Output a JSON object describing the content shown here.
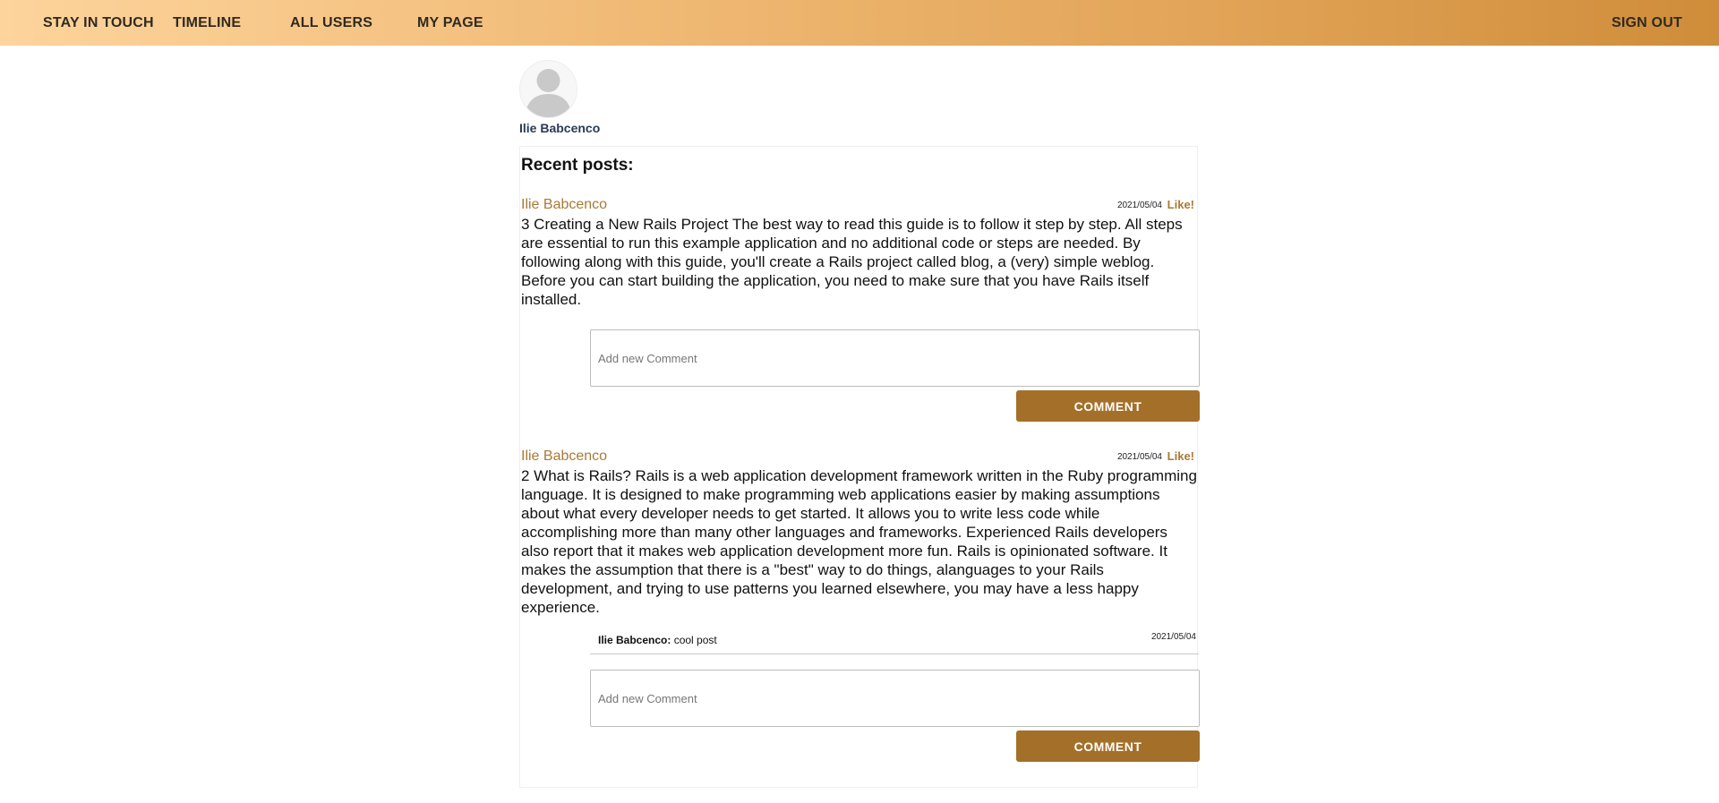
{
  "nav": {
    "stay_in_touch": "STAY IN TOUCH",
    "timeline": "TIMELINE",
    "all_users": "ALL USERS",
    "my_page": "MY PAGE",
    "sign_out": "SIGN OUT"
  },
  "profile": {
    "name": "Ilie Babcenco"
  },
  "recent_posts": {
    "heading": "Recent posts:",
    "like_label": "Like!",
    "comment_placeholder": "Add new Comment",
    "comment_button": "COMMENT",
    "posts": [
      {
        "author": "Ilie Babcenco",
        "date": "2021/05/04",
        "body": "3 Creating a New Rails Project The best way to read this guide is to follow it step by step. All steps are essential to run this example application and no additional code or steps are needed. By following along with this guide, you'll create a Rails project called blog, a (very) simple weblog. Before you can start building the application, you need to make sure that you have Rails itself installed.",
        "comments": []
      },
      {
        "author": "Ilie Babcenco",
        "date": "2021/05/04",
        "body": "2 What is Rails? Rails is a web application development framework written in the Ruby programming language. It is designed to make programming web applications easier by making assumptions about what every developer needs to get started. It allows you to write less code while accomplishing more than many other languages and frameworks. Experienced Rails developers also report that it makes web application development more fun. Rails is opinionated software. It makes the assumption that there is a \"best\" way to do things, alanguages to your Rails development, and trying to use patterns you learned elsewhere, you may have a less happy experience.",
        "comments": [
          {
            "author": "Ilie Babcenco:",
            "text": "cool post",
            "date": "2021/05/04"
          }
        ]
      }
    ]
  }
}
